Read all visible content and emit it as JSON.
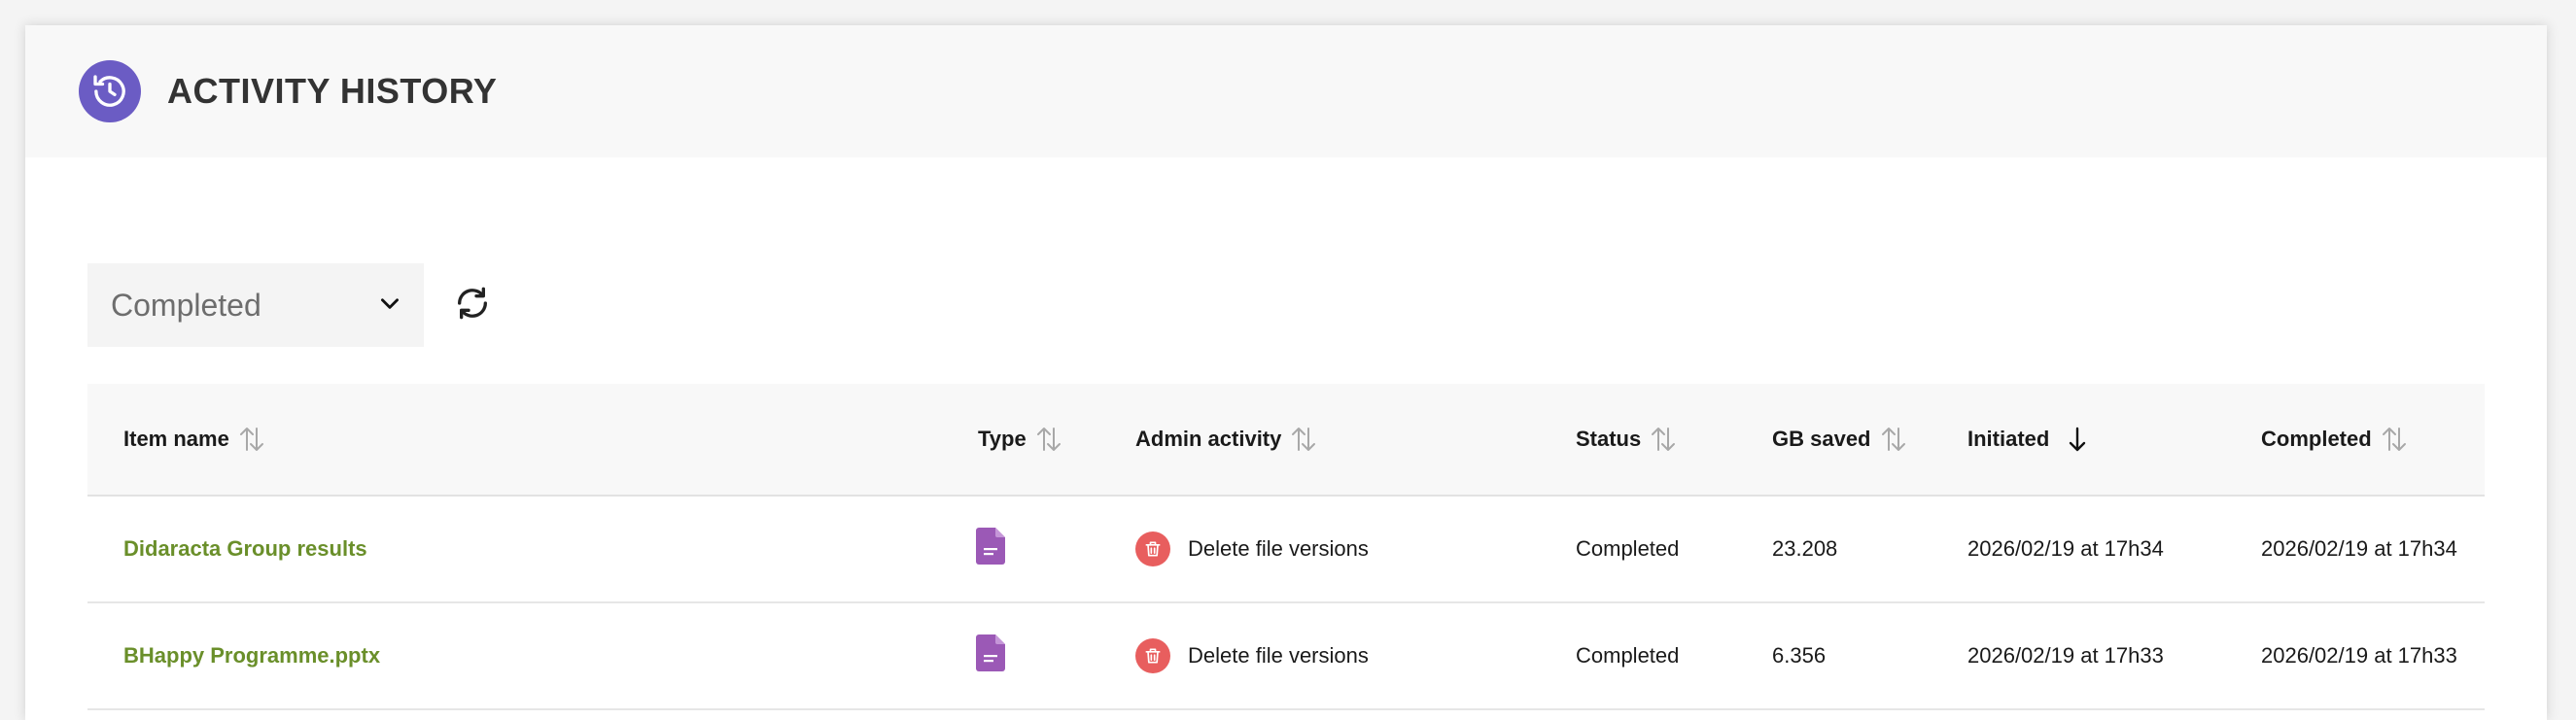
{
  "header": {
    "title": "ACTIVITY HISTORY",
    "icon": "history-icon"
  },
  "filter": {
    "selected": "Completed"
  },
  "table": {
    "columns": [
      "Item name",
      "Type",
      "Admin activity",
      "Status",
      "GB saved",
      "Initiated",
      "Completed"
    ],
    "rows": [
      {
        "item_name": "Didaracta Group results",
        "type_icon": "document-icon",
        "activity": "Delete file versions",
        "status": "Completed",
        "gb_saved": "23.208",
        "initiated": "2026/02/19 at 17h34",
        "completed": "2026/02/19 at 17h34"
      },
      {
        "item_name": "BHappy Programme.pptx",
        "type_icon": "document-icon",
        "activity": "Delete file versions",
        "status": "Completed",
        "gb_saved": "6.356",
        "initiated": "2026/02/19 at 17h33",
        "completed": "2026/02/19 at 17h33"
      }
    ]
  },
  "colors": {
    "accent": "#6b5cc4",
    "link": "#6a8f2a",
    "doc_icon": "#9b59b6",
    "delete_badge": "#e85e5e"
  }
}
